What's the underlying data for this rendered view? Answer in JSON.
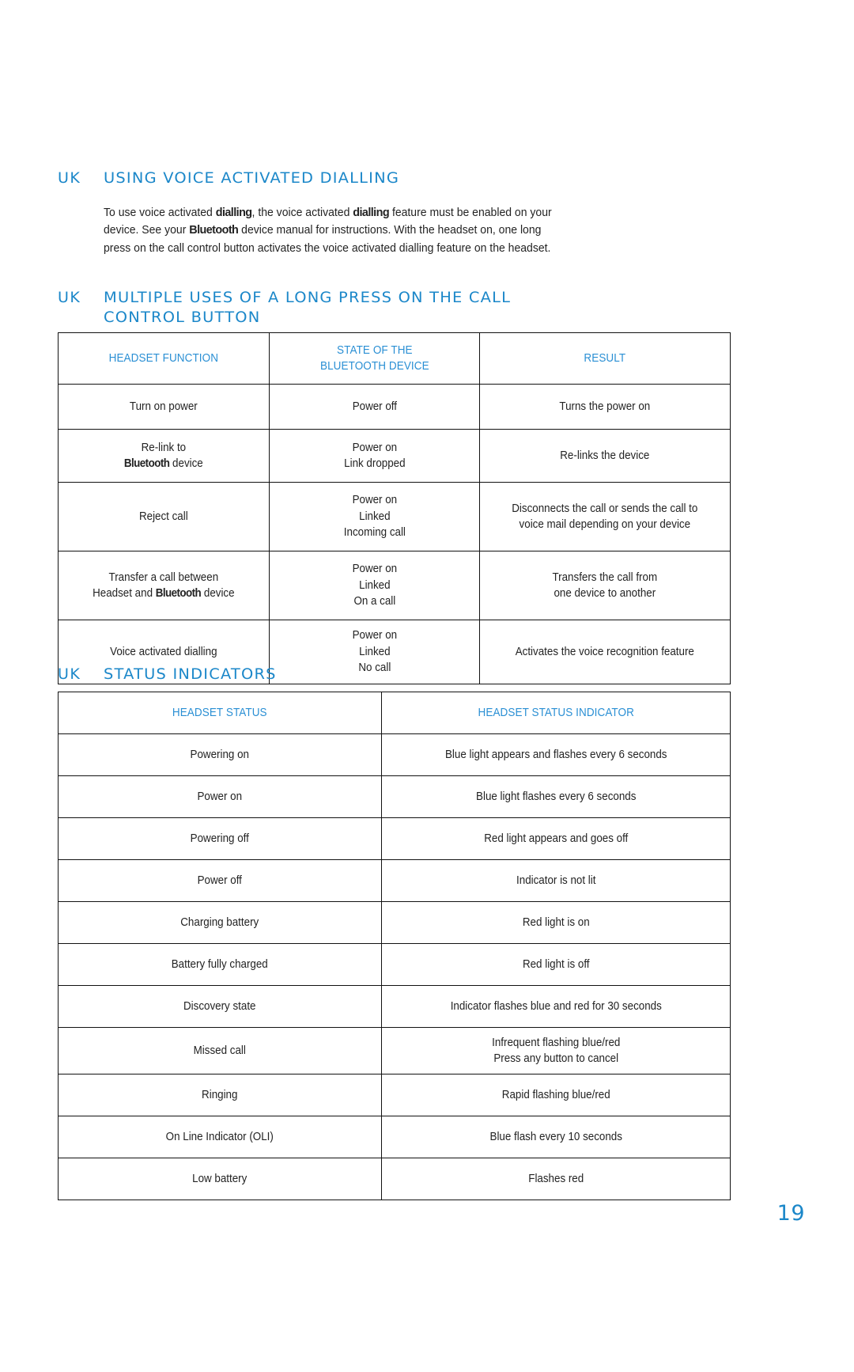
{
  "language_tag": "UK",
  "sections": {
    "voice_dialling": {
      "heading": "USING VOICE ACTIVATED DIALLING",
      "paragraph_parts": {
        "p1": "To use voice activated ",
        "b1": "dialling",
        "p2": ", the voice activated ",
        "b2": "dialling",
        "p3": " feature must be enabled on your device. See your ",
        "b3": "Bluetooth",
        "p4": " device manual for instructions. With the headset on, one long press on the call control button activates the voice activated dialling feature on the headset."
      },
      "paragraph_full": "To use voice activated dialling, the voice activated dialling feature must be enabled on your device. See your Bluetooth device manual for instructions. With the headset on, one long press on the call control button activates the voice activated dialling feature on the headset."
    },
    "long_press": {
      "heading_line1": "MULTIPLE USES OF A LONG PRESS ON THE CALL",
      "heading_line2": "CONTROL BUTTON",
      "heading": "MULTIPLE USES OF A LONG PRESS ON THE CALL CONTROL BUTTON"
    },
    "status_indicators": {
      "heading": "STATUS INDICATORS"
    }
  },
  "table_long_press": {
    "headers": [
      "HEADSET FUNCTION",
      "STATE OF THE\nBLUETOOTH DEVICE",
      "RESULT"
    ],
    "header_line1_col2": "STATE OF THE",
    "header_line2_col2": "BLUETOOTH DEVICE",
    "rows": [
      {
        "function_pre": "Turn on power",
        "function_post": "",
        "state": "Power off",
        "result": "Turns the power on"
      },
      {
        "function_pre": "Re-link to\n",
        "function_bold": "Bluetooth",
        "function_post": " device",
        "state": "Power on\nLink dropped",
        "result": "Re-links the device"
      },
      {
        "function_pre": "Reject call",
        "function_post": "",
        "state": "Power on\nLinked\nIncoming call",
        "result": "Disconnects the call or sends the call to\nvoice mail depending on your device"
      },
      {
        "function_pre": "Transfer a call between\nHeadset and ",
        "function_bold": "Bluetooth",
        "function_post": " device",
        "state": "Power on\nLinked\nOn a call",
        "result": "Transfers the call from\none device to another"
      },
      {
        "function_pre": "Voice activated dialling",
        "function_post": "",
        "state": "Power on\nLinked\nNo call",
        "result": "Activates the voice recognition feature"
      }
    ]
  },
  "table_status": {
    "headers": [
      "HEADSET STATUS",
      "HEADSET STATUS INDICATOR"
    ],
    "rows": [
      {
        "status": "Powering on",
        "indicator": "Blue light appears and flashes every 6 seconds"
      },
      {
        "status": "Power on",
        "indicator": "Blue light flashes every 6 seconds"
      },
      {
        "status": "Powering off",
        "indicator": "Red light appears and goes off"
      },
      {
        "status": "Power off",
        "indicator": "Indicator is not lit"
      },
      {
        "status": "Charging battery",
        "indicator": "Red light is on"
      },
      {
        "status": "Battery fully charged",
        "indicator": "Red light is off"
      },
      {
        "status": "Discovery state",
        "indicator": "Indicator flashes blue and red for 30 seconds"
      },
      {
        "status": "Missed call",
        "indicator": "Infrequent flashing blue/red\nPress any button to cancel"
      },
      {
        "status": "Ringing",
        "indicator": "Rapid flashing blue/red"
      },
      {
        "status": "On Line Indicator (OLI)",
        "indicator": "Blue flash every 10 seconds"
      },
      {
        "status": "Low battery",
        "indicator": "Flashes red"
      }
    ]
  },
  "page_number": "19",
  "colors": {
    "heading_blue": "#1b87c9",
    "table_header_blue": "#2a8fd4",
    "border_black": "#121212",
    "body_text": "#232323",
    "background": "#ffffff"
  }
}
